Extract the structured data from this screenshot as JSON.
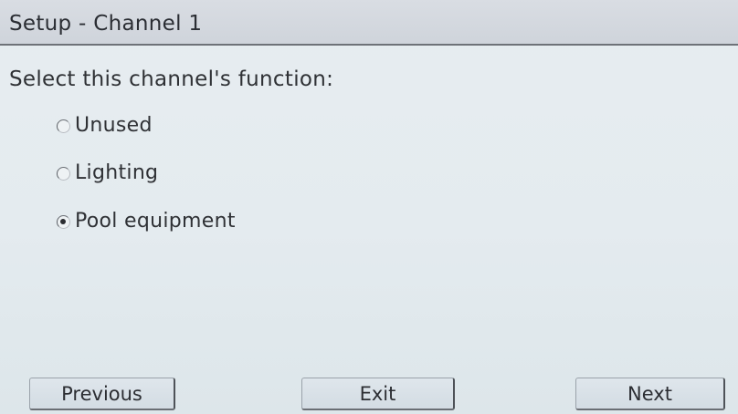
{
  "window": {
    "title": "Setup - Channel 1"
  },
  "main": {
    "prompt": "Select this channel's function:",
    "options": [
      {
        "label": "Unused",
        "selected": false
      },
      {
        "label": "Lighting",
        "selected": false
      },
      {
        "label": "Pool equipment",
        "selected": true
      }
    ]
  },
  "footer": {
    "previous_label": "Previous",
    "exit_label": "Exit",
    "next_label": "Next"
  }
}
